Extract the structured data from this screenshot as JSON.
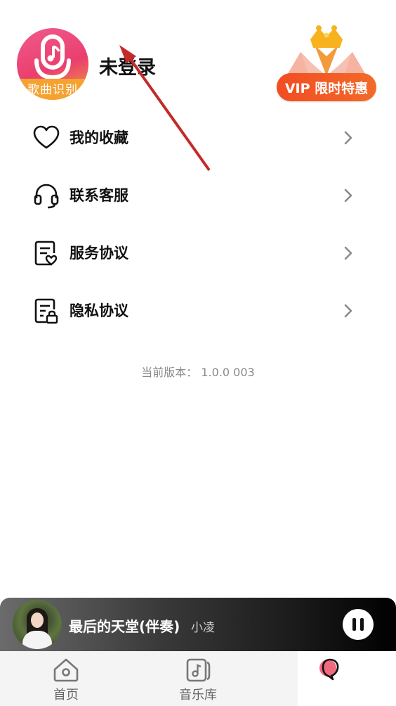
{
  "header": {
    "avatar_caption": "歌曲识别",
    "login_status": "未登录",
    "vip_label": "VIP 限时特惠"
  },
  "menu": [
    {
      "label": "我的收藏",
      "icon": "heart-icon"
    },
    {
      "label": "联系客服",
      "icon": "headset-icon"
    },
    {
      "label": "服务协议",
      "icon": "document-heart-icon"
    },
    {
      "label": "隐私协议",
      "icon": "document-lock-icon"
    }
  ],
  "version_text": "当前版本：  1.0.0 003",
  "player": {
    "title": "最后的天堂(伴奏)",
    "artist": "小凌"
  },
  "tabs": [
    {
      "label": "首页",
      "icon": "home-icon"
    },
    {
      "label": "音乐库",
      "icon": "music-library-icon"
    },
    {
      "label": "",
      "icon": "profile-icon"
    }
  ],
  "colors": {
    "accent": "#f24d22",
    "avatar_pink": "#ea3f6e",
    "avatar_orange": "#f5a231"
  }
}
